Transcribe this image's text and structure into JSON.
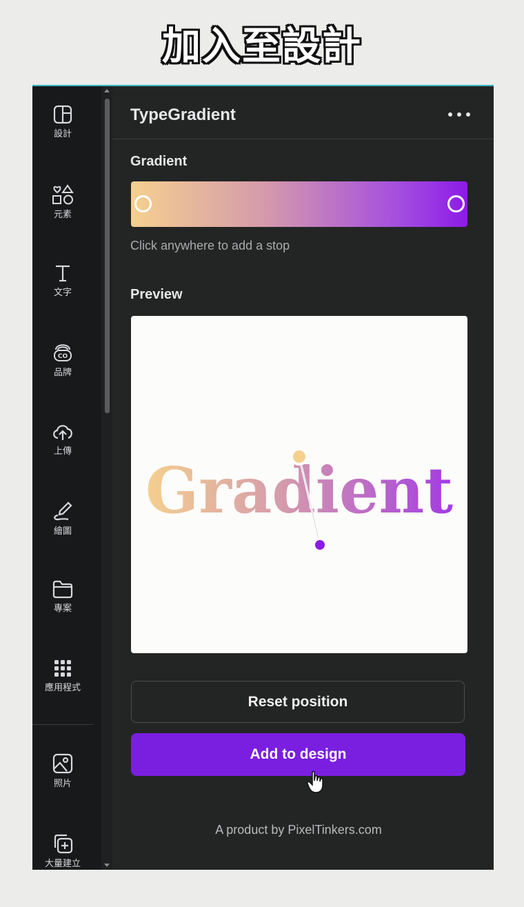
{
  "caption": "加入至設計",
  "rail": {
    "items": [
      {
        "label": "設計",
        "icon": "layout-icon"
      },
      {
        "label": "元素",
        "icon": "shapes-icon"
      },
      {
        "label": "文字",
        "icon": "text-icon"
      },
      {
        "label": "品牌",
        "icon": "brand-icon"
      },
      {
        "label": "上傳",
        "icon": "cloud-upload-icon"
      },
      {
        "label": "繪圖",
        "icon": "draw-icon"
      },
      {
        "label": "專案",
        "icon": "folder-icon"
      },
      {
        "label": "應用程式",
        "icon": "apps-grid-icon"
      },
      {
        "label": "照片",
        "icon": "image-icon"
      },
      {
        "label": "大量建立",
        "icon": "bulk-create-icon"
      }
    ]
  },
  "panel": {
    "title": "TypeGradient",
    "gradient_label": "Gradient",
    "gradient_colors": [
      "#f5d08f",
      "#8c1be6"
    ],
    "hint": "Click anywhere to add a stop",
    "preview_label": "Preview",
    "preview_text": "Gradient",
    "reset_label": "Reset position",
    "add_label": "Add to design",
    "footer": "A product by PixelTinkers.com"
  },
  "colors": {
    "accent": "#7a1ee0",
    "panel_bg": "#232524",
    "rail_bg": "#18191b"
  }
}
